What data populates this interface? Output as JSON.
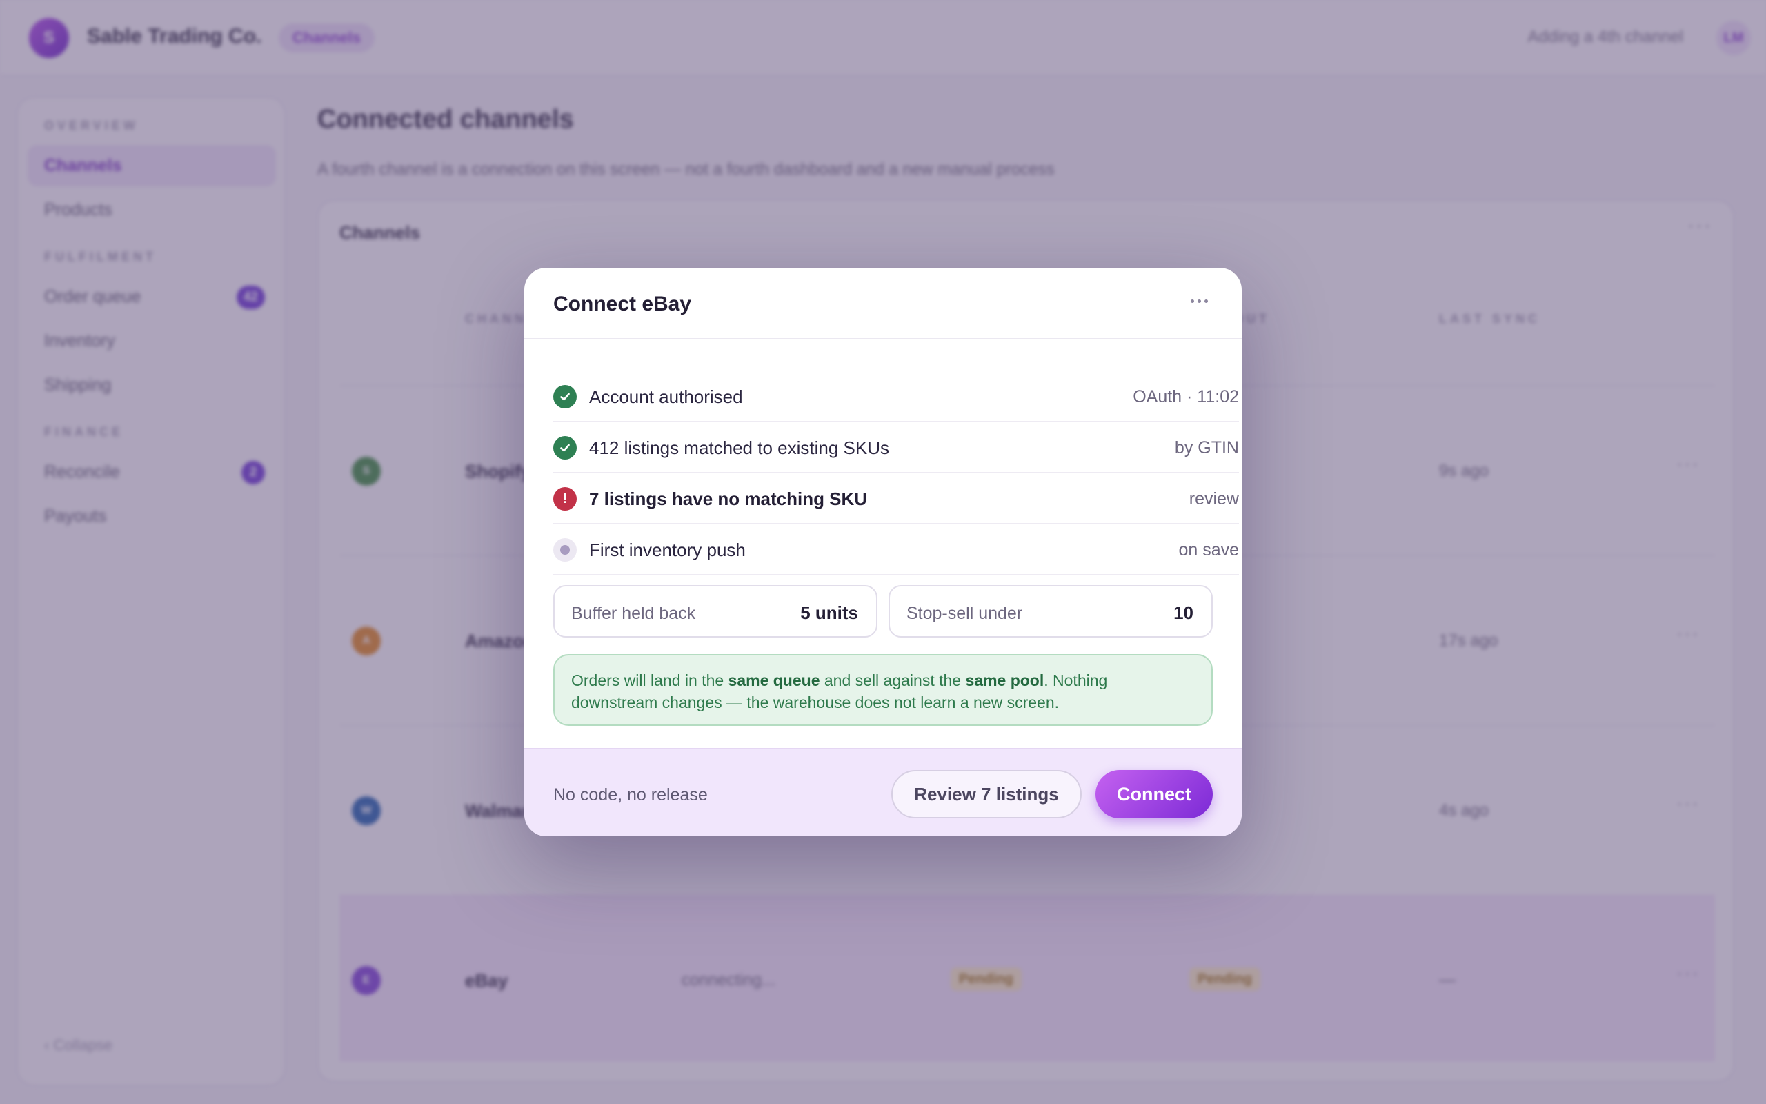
{
  "app": {
    "logo_letter": "S",
    "company": "Sable Trading Co.",
    "breadcrumb": "Channels",
    "topbar_status": "Adding a 4th channel",
    "user_initials": "LM"
  },
  "sidebar": {
    "sections": [
      {
        "label": "OVERVIEW"
      },
      {
        "label": "FULFILMENT"
      },
      {
        "label": "FINANCE"
      }
    ],
    "items": [
      {
        "label": "Channels"
      },
      {
        "label": "Products"
      },
      {
        "label": "Order queue",
        "badge": "42"
      },
      {
        "label": "Inventory"
      },
      {
        "label": "Shipping"
      },
      {
        "label": "Reconcile",
        "badge": "2"
      },
      {
        "label": "Payouts"
      }
    ],
    "collapse": "‹ Collapse"
  },
  "page": {
    "title": "Connected channels",
    "subtitle": "A fourth channel is a connection on this screen — not a fourth dashboard and a new manual process"
  },
  "channels_card": {
    "title": "Channels",
    "columns": [
      "CHANNEL",
      "OUT",
      "LAST SYNC"
    ],
    "rows": [
      {
        "letter": "S",
        "name": "Shopify",
        "status": "",
        "c1": "",
        "c2": "",
        "last_sync": "9s ago",
        "color": "#3b8a3e"
      },
      {
        "letter": "A",
        "name": "Amazon",
        "status": "",
        "c1": "",
        "c2": "",
        "last_sync": "17s ago",
        "color": "#e0861f"
      },
      {
        "letter": "W",
        "name": "Walmart",
        "status": "",
        "c1": "",
        "c2": "",
        "last_sync": "4s ago",
        "color": "#1f5fae"
      },
      {
        "letter": "E",
        "name": "eBay",
        "status": "connecting...",
        "c1": "Pending",
        "c2": "Pending",
        "last_sync": "—",
        "color": "#7b3ed6"
      }
    ]
  },
  "modal": {
    "title": "Connect eBay",
    "checks": [
      {
        "label": "Account authorised",
        "meta": "OAuth · 11:02",
        "state": "ok"
      },
      {
        "label": "412 listings matched to existing SKUs",
        "meta": "by GTIN",
        "state": "ok"
      },
      {
        "label": "7 listings have no matching SKU",
        "meta": "review",
        "state": "error"
      },
      {
        "label": "First inventory push",
        "meta": "on save",
        "state": "pending"
      }
    ],
    "fields": {
      "buffer_label": "Buffer held back",
      "buffer_value": "5 units",
      "stopsell_label": "Stop-sell under",
      "stopsell_value": "10"
    },
    "note": {
      "p1": "Orders will land in the ",
      "b1": "same queue",
      "p2": " and sell against the ",
      "b2": "same pool",
      "p3": ". Nothing downstream changes — the warehouse does not learn a new screen."
    },
    "footer_note": "No code, no release",
    "review_button": "Review 7 listings",
    "connect_button": "Connect"
  }
}
